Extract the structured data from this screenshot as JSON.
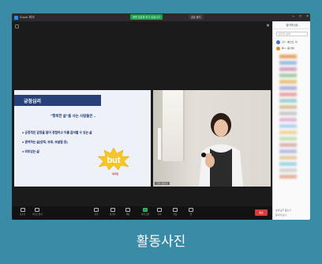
{
  "window": {
    "app_name": "Zoom 회의",
    "share_banner": "화면 공유를 보고 있습니다",
    "share_stop": "공유 중지",
    "controls": [
      "–",
      "□",
      "×"
    ]
  },
  "slide": {
    "title": "긍정심리",
    "subtitle": "\"행복한 삶\"을 사는 사람들은 ..",
    "bullets": [
      "● 긍정적인 감정을 많이 경험하고 이를 음미할 수 있는 삶",
      "● 관여하는 삶(양육, 보호, 보살핌 등)",
      "● 의미있는 삶"
    ],
    "but_text": "but",
    "tag": "하지만"
  },
  "camera": {
    "label": "코디 상담사"
  },
  "toolbar": {
    "items": [
      {
        "label": "음소거",
        "icon": "mic-icon"
      },
      {
        "label": "비디오 중지",
        "icon": "camera-icon"
      },
      {
        "label": "보안",
        "icon": "shield-icon"
      },
      {
        "label": "참가자",
        "icon": "people-icon"
      },
      {
        "label": "채팅",
        "icon": "chat-icon"
      },
      {
        "label": "화면 공유",
        "icon": "share-icon"
      },
      {
        "label": "기록",
        "icon": "record-icon"
      },
      {
        "label": "반응",
        "icon": "reaction-icon"
      },
      {
        "label": "앱",
        "icon": "apps-icon"
      }
    ],
    "end_label": "종료"
  },
  "panel": {
    "title": "참가자 (9)",
    "search_placeholder": "참가자 검색",
    "participants": [
      {
        "name": "김○○ (호스트, 나)",
        "color": "#3a78c9"
      },
      {
        "name": "박○○ (참가자)",
        "color": "#e08a2b"
      }
    ],
    "footer_1": "초대  모두 음소거",
    "footer_2": "참가자 보기"
  },
  "caption": "활동사진",
  "colors": {
    "background": "#3a8ba6",
    "slide_header": "#27407a",
    "share_green": "#1e9e4e",
    "end_red": "#d93a3a"
  }
}
